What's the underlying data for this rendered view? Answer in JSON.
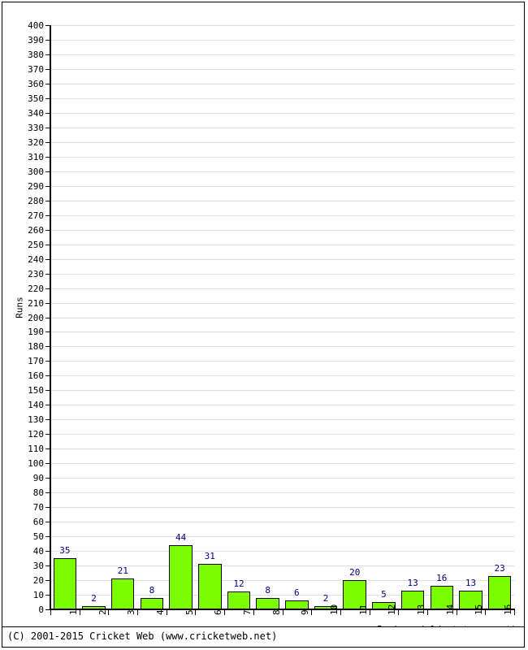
{
  "chart_data": {
    "type": "bar",
    "title": "",
    "subtitle": "",
    "xlabel": "Innings (oldest to newest)",
    "ylabel": "Runs",
    "categories": [
      "1",
      "2",
      "3",
      "4",
      "5",
      "6",
      "7",
      "8",
      "9",
      "10",
      "11",
      "12",
      "13",
      "14",
      "15",
      "16"
    ],
    "values": [
      35,
      2,
      21,
      8,
      44,
      31,
      12,
      8,
      6,
      2,
      20,
      5,
      13,
      16,
      13,
      23
    ],
    "value_labels": [
      "35",
      "2",
      "21",
      "8",
      "44",
      "31",
      "12",
      "8",
      "6",
      "2",
      "20",
      "5",
      "13",
      "16",
      "13",
      "23"
    ],
    "ylim": [
      0,
      400
    ],
    "ytick_step": 10,
    "yticks": [
      0,
      10,
      20,
      30,
      40,
      50,
      60,
      70,
      80,
      90,
      100,
      110,
      120,
      130,
      140,
      150,
      160,
      170,
      180,
      190,
      200,
      210,
      220,
      230,
      240,
      250,
      260,
      270,
      280,
      290,
      300,
      310,
      320,
      330,
      340,
      350,
      360,
      370,
      380,
      390,
      400
    ],
    "ytick_labels": [
      "0",
      "10",
      "20",
      "30",
      "40",
      "50",
      "60",
      "70",
      "80",
      "90",
      "100",
      "110",
      "120",
      "130",
      "140",
      "150",
      "160",
      "170",
      "180",
      "190",
      "200",
      "210",
      "220",
      "230",
      "240",
      "250",
      "260",
      "270",
      "280",
      "290",
      "300",
      "310",
      "320",
      "330",
      "340",
      "350",
      "360",
      "370",
      "380",
      "390",
      "400"
    ],
    "grid": true,
    "legend": null,
    "legend_position": "none",
    "series": [
      {
        "name": "Runs",
        "values": [
          35,
          2,
          21,
          8,
          44,
          31,
          12,
          8,
          6,
          2,
          20,
          5,
          13,
          16,
          13,
          23
        ]
      }
    ],
    "colors": {
      "bar_fill": "#7CFC00",
      "bar_border": "#000000",
      "value_label": "#00008B",
      "gridline": "#dddddd",
      "axis": "#000000",
      "background": "#ffffff"
    }
  },
  "footer": {
    "copyright": "(C) 2001-2015 Cricket Web (www.cricketweb.net)"
  }
}
